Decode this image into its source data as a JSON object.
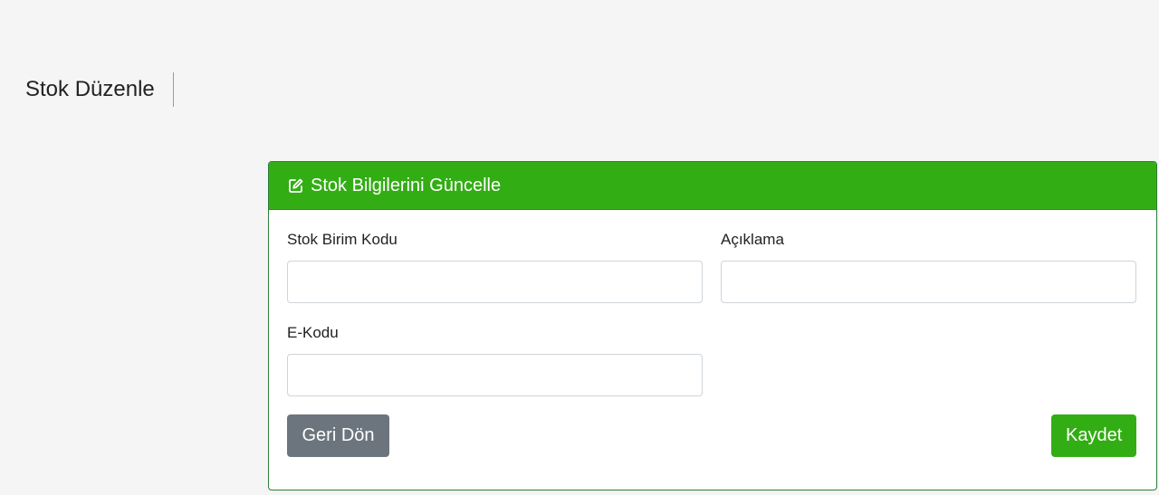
{
  "page": {
    "title": "Stok Düzenle"
  },
  "card": {
    "header_title": "Stok Bilgilerini Güncelle",
    "header_icon": "edit-icon",
    "header_color": "#33ad14"
  },
  "form": {
    "stock_unit_code": {
      "label": "Stok Birim Kodu",
      "value": ""
    },
    "description": {
      "label": "Açıklama",
      "value": ""
    },
    "e_code": {
      "label": "E-Kodu",
      "value": ""
    }
  },
  "buttons": {
    "back_label": "Geri Dön",
    "save_label": "Kaydet"
  }
}
